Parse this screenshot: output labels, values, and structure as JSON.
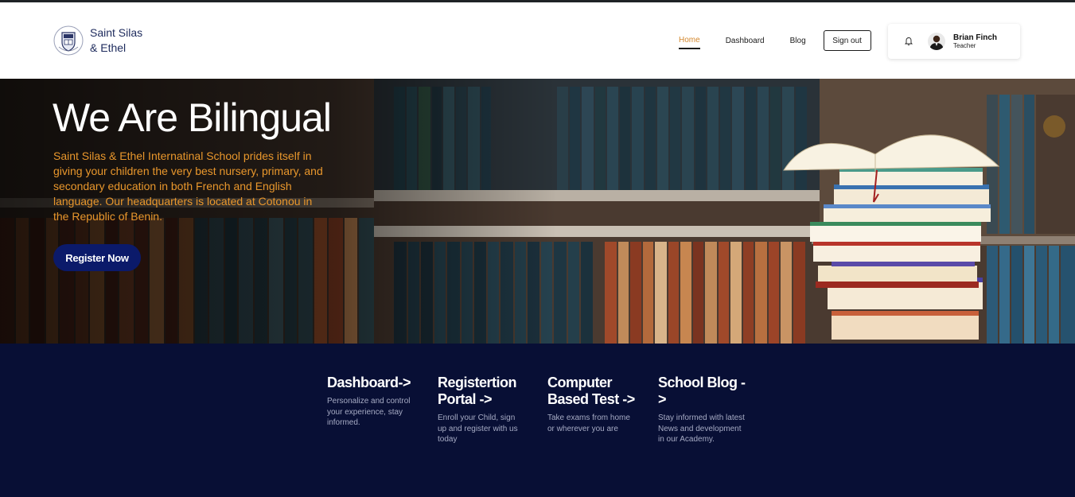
{
  "brand": {
    "name_line1": "Saint Silas",
    "name_line2": "& Ethel"
  },
  "nav": {
    "items": [
      {
        "label": "Home",
        "active": true
      },
      {
        "label": "Dashboard",
        "active": false
      },
      {
        "label": "Blog",
        "active": false
      }
    ],
    "signout_label": "Sign out"
  },
  "user": {
    "name": "Brian Finch",
    "role": "Teacher",
    "notification_icon": "bell-icon"
  },
  "hero": {
    "title": "We Are Bilingual",
    "description": "Saint Silas & Ethel Internatinal School prides itself in giving your children the very best nursery, primary, and secondary education in both French and English language. Our headquarters is located at Cotonou in the Republic of Benin.",
    "cta_label": "Register Now"
  },
  "features": [
    {
      "title": "Dashboard->",
      "description": "Personalize and control your experience, stay informed."
    },
    {
      "title": "Registertion Portal ->",
      "description": "Enroll your Child, sign up and register with us today"
    },
    {
      "title": "Computer Based Test ->",
      "description": "Take exams from home or wherever you are"
    },
    {
      "title": "School Blog ->",
      "description": "Stay informed with latest News and development in our Academy."
    }
  ],
  "colors": {
    "accent": "#e9972c",
    "brand_navy": "#1d2a5c",
    "cta": "#0b1a6a",
    "footer_bg": "#080f35"
  }
}
